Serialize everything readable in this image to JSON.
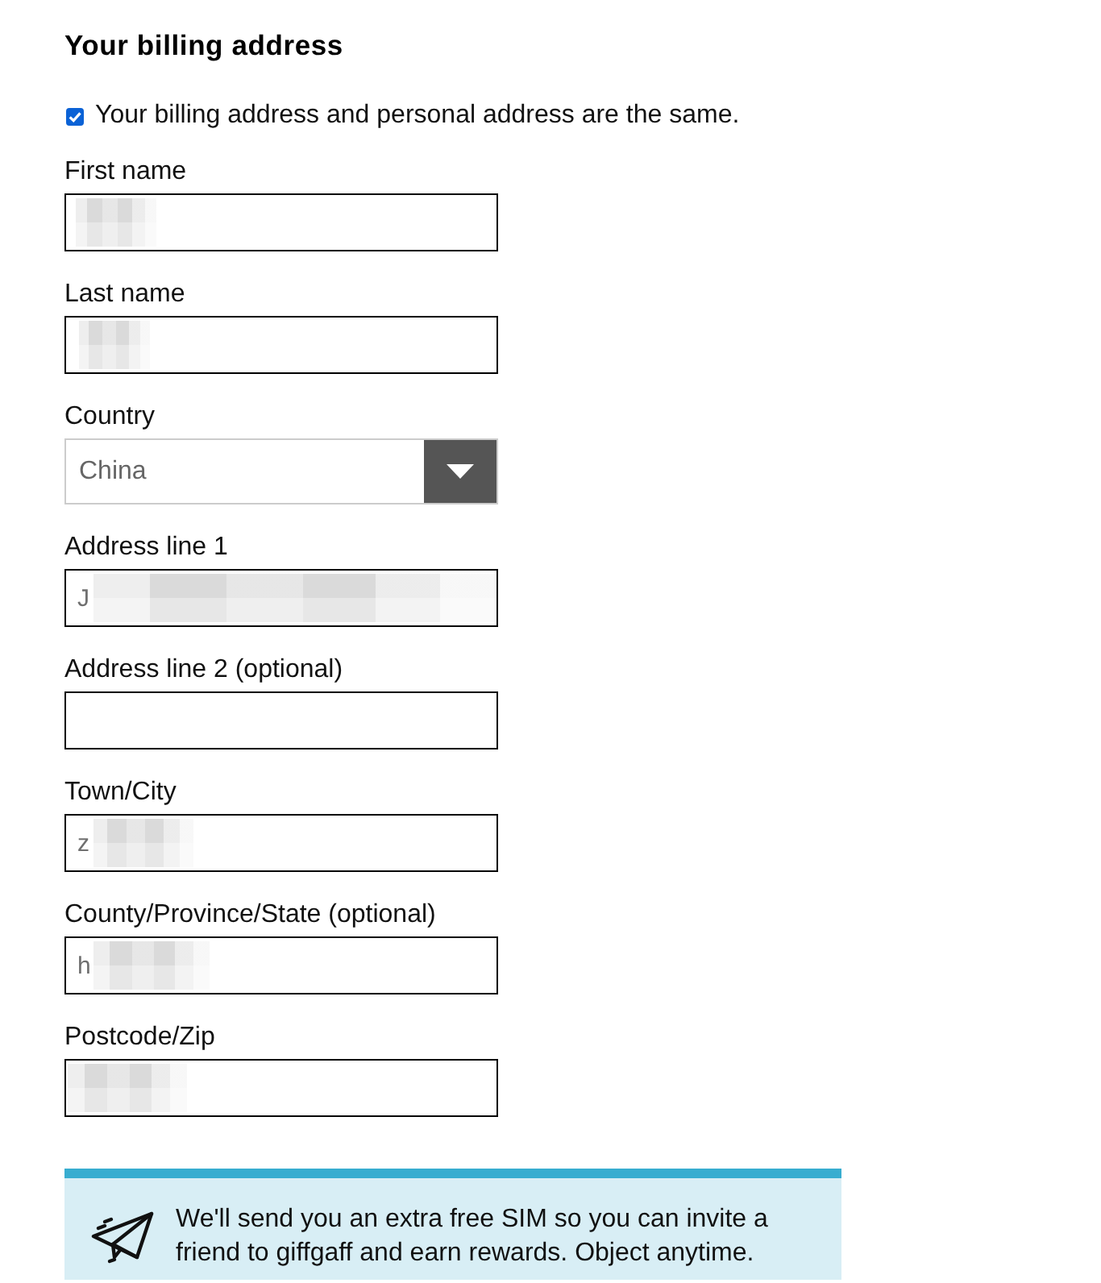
{
  "heading": "Your billing address",
  "same_address": {
    "label": "Your billing address and personal address are the same.",
    "checked": true
  },
  "fields": [
    {
      "kind": "text",
      "label": "First name",
      "redacted": true
    },
    {
      "kind": "text",
      "label": "Last name",
      "redacted": true
    },
    {
      "kind": "select",
      "label": "Country",
      "value": "China"
    },
    {
      "kind": "text",
      "label": "Address line 1",
      "value": "J",
      "redacted": true
    },
    {
      "kind": "text",
      "label": "Address line 2 (optional)",
      "redacted": false
    },
    {
      "kind": "text",
      "label": "Town/City",
      "value": "z",
      "redacted": true
    },
    {
      "kind": "text",
      "label": "County/Province/State (optional)",
      "value": "h",
      "redacted": true
    },
    {
      "kind": "text",
      "label": "Postcode/Zip",
      "redacted": true
    }
  ],
  "banner": {
    "text": "We'll send you an extra free SIM so you can invite a friend to giffgaff and earn rewards. Object anytime."
  }
}
